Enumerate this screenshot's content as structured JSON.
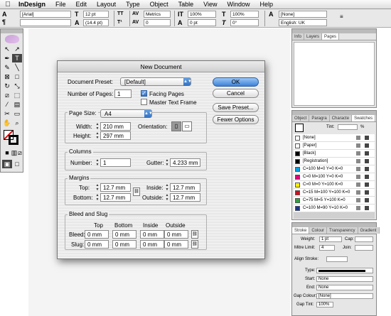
{
  "menubar": {
    "app": "InDesign",
    "menus": [
      "File",
      "Edit",
      "Layout",
      "Type",
      "Object",
      "Table",
      "View",
      "Window",
      "Help"
    ]
  },
  "control": {
    "font": "[Arial]",
    "size": "12 pt",
    "leading": "(14.4 pt)",
    "kerning": "Metrics",
    "tracking": "0",
    "scale_v": "100%",
    "scale_h": "100%",
    "baseline": "0 pt",
    "skew": "0°",
    "style": "[None]",
    "language": "English: UK"
  },
  "panels": {
    "pages_tabs": [
      "Info",
      "Layers",
      "Pages"
    ],
    "swatches_tabs": [
      "Object",
      "Paragra",
      "Characte",
      "Swatches"
    ],
    "tint_label": "Tint:",
    "tint_unit": "%",
    "swatches": [
      {
        "name": "[None]",
        "color": "#ffffff"
      },
      {
        "name": "[Paper]",
        "color": "#ffffff"
      },
      {
        "name": "[Black]",
        "color": "#000000"
      },
      {
        "name": "[Registration]",
        "color": "#000000"
      },
      {
        "name": "C=100 M=0 Y=0 K=0",
        "color": "#00a0e0"
      },
      {
        "name": "C=0 M=100 Y=0 K=0",
        "color": "#e0007a"
      },
      {
        "name": "C=0 M=0 Y=100 K=0",
        "color": "#ffee00"
      },
      {
        "name": "C=15 M=100 Y=100 K=0",
        "color": "#d01020"
      },
      {
        "name": "C=75 M=5 Y=100 K=0",
        "color": "#2ea040"
      },
      {
        "name": "C=100 M=90 Y=10 K=0",
        "color": "#1a3590"
      }
    ],
    "stroke_tabs": [
      "Stroke",
      "Colour",
      "Transparency",
      "Gradient"
    ],
    "stroke": {
      "weight_label": "Weight:",
      "weight": "1 pt",
      "cap_label": "Cap:",
      "mitre_label": "Mitre Limit:",
      "mitre": "4",
      "join_label": "Join:",
      "align_label": "Align Stroke:",
      "type_label": "Type:",
      "start_label": "Start:",
      "start": "None",
      "end_label": "End:",
      "end": "None",
      "gapcolour_label": "Gap Colour:",
      "gapcolour": "[None]",
      "gaptint_label": "Gap Tint:",
      "gaptint": "100%"
    }
  },
  "dialog": {
    "title": "New Document",
    "preset_label": "Document Preset:",
    "preset_value": "[Default]",
    "pages_label": "Number of Pages:",
    "pages_value": "1",
    "facing_pages": "Facing Pages",
    "master_text_frame": "Master Text Frame",
    "page_size_label": "Page Size:",
    "page_size_value": "A4",
    "width_label": "Width:",
    "width_value": "210 mm",
    "height_label": "Height:",
    "height_value": "297 mm",
    "orientation_label": "Orientation:",
    "columns_label": "Columns",
    "number_label": "Number:",
    "number_value": "1",
    "gutter_label": "Gutter:",
    "gutter_value": "4.233 mm",
    "margins_label": "Margins",
    "top_label": "Top:",
    "top_value": "12.7 mm",
    "bottom_label": "Bottom:",
    "bottom_value": "12.7 mm",
    "inside_label": "Inside:",
    "inside_value": "12.7 mm",
    "outside_label": "Outside:",
    "outside_value": "12.7 mm",
    "bleed_slug_label": "Bleed and Slug",
    "col_top": "Top",
    "col_bottom": "Bottom",
    "col_inside": "Inside",
    "col_outside": "Outside",
    "bleed_label": "Bleed:",
    "slug_label": "Slug:",
    "zero": "0 mm",
    "ok": "OK",
    "cancel": "Cancel",
    "save_preset": "Save Preset...",
    "fewer_options": "Fewer Options"
  }
}
